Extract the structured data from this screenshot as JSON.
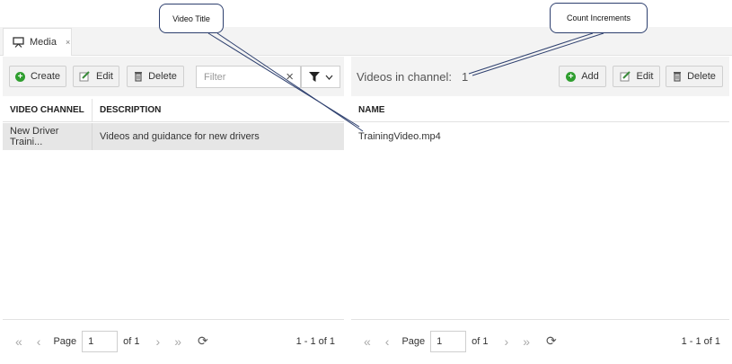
{
  "tab": {
    "label": "Media",
    "close": "×"
  },
  "left": {
    "buttons": {
      "create": "Create",
      "edit": "Edit",
      "delete": "Delete"
    },
    "filter_placeholder": "Filter",
    "columns": [
      "VIDEO CHANNEL",
      "DESCRIPTION"
    ],
    "rows": [
      {
        "channel": "New Driver Traini...",
        "description": "Videos and guidance for new drivers"
      }
    ],
    "pager": {
      "page_label": "Page",
      "page_value": "1",
      "of": "of 1",
      "range": "1 - 1 of 1"
    }
  },
  "right": {
    "videos_label": "Videos in channel:",
    "videos_count": "1",
    "buttons": {
      "add": "Add",
      "edit": "Edit",
      "delete": "Delete"
    },
    "columns": [
      "NAME"
    ],
    "rows": [
      {
        "name": "TrainingVideo.mp4"
      }
    ],
    "pager": {
      "page_label": "Page",
      "page_value": "1",
      "of": "of 1",
      "range": "1 - 1 of 1"
    }
  },
  "callouts": {
    "video_title": "Video Title",
    "count_increments": "Count Increments"
  },
  "colors": {
    "accent_green": "#2f9e2f",
    "selected_row": "#e6e6e6",
    "callout_border": "#2d3f6e"
  }
}
